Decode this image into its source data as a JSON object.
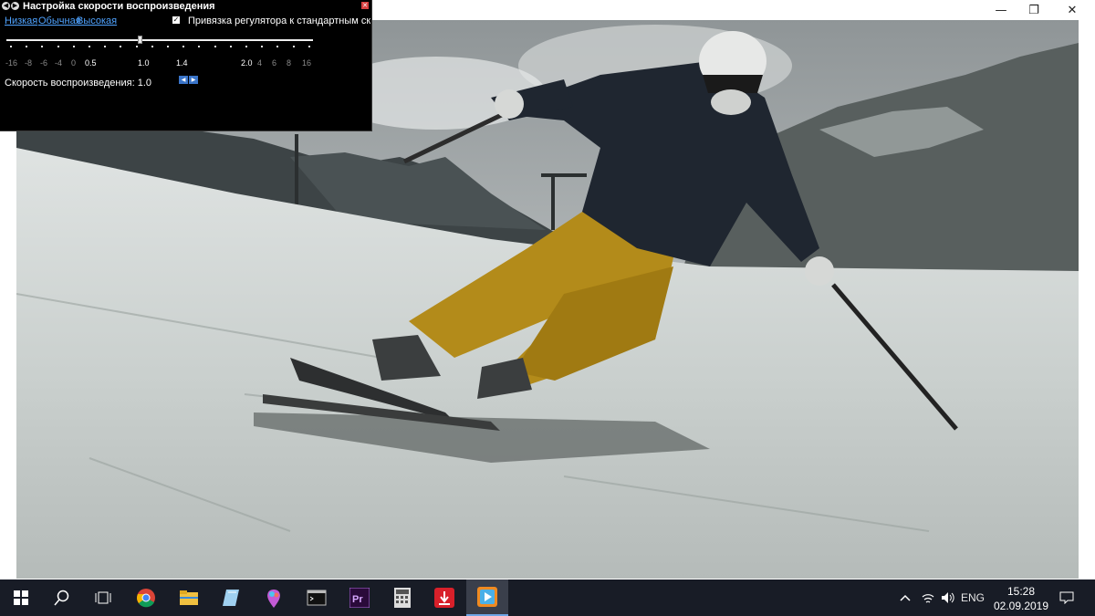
{
  "window": {
    "minimize_icon": "minimize-icon",
    "restore_icon": "restore-icon",
    "close_icon": "close-icon"
  },
  "speed_dialog": {
    "title": "Настройка скорости воспроизведения",
    "presets": [
      "Низкая",
      "Обычная",
      "Высокая"
    ],
    "snap_checked": true,
    "snap_label": "Привязка регулятора к стандартным скорос",
    "slider_value": 1.0,
    "tick_labels": [
      {
        "text": "-16",
        "dim": true
      },
      {
        "text": "-8",
        "dim": true
      },
      {
        "text": "-6",
        "dim": true
      },
      {
        "text": "-4",
        "dim": true
      },
      {
        "text": "0",
        "dim": true
      },
      {
        "text": "0.5",
        "dim": false
      },
      {
        "text": "1.0",
        "dim": false
      },
      {
        "text": "1.4",
        "dim": false
      },
      {
        "text": "2.0",
        "dim": false
      },
      {
        "text": "4",
        "dim": true
      },
      {
        "text": "6",
        "dim": true
      },
      {
        "text": "8",
        "dim": true
      },
      {
        "text": "16",
        "dim": true
      }
    ],
    "rate_label": "Скорость воспроизведения: 1.0"
  },
  "taskbar": {
    "apps": [
      "windows-start",
      "search",
      "task-view",
      "chrome",
      "file-explorer",
      "notepad-plus",
      "paint-3d",
      "terminal",
      "premiere-pro",
      "calculator",
      "download-manager",
      "media-player"
    ],
    "active_app": "media-player",
    "tray": {
      "language": "ENG",
      "time": "15:28",
      "date": "02.09.2019"
    }
  },
  "colors": {
    "link": "#4fa3ff",
    "taskbar": "#181c26",
    "dialog_bg": "#000000"
  }
}
